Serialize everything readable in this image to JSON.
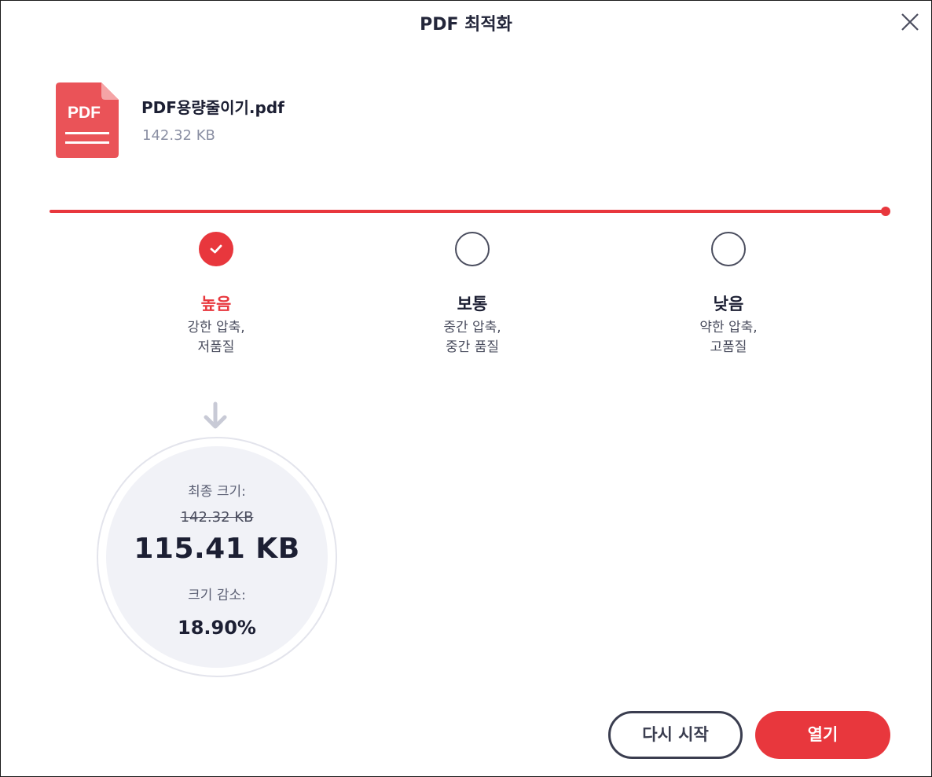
{
  "dialog": {
    "title": "PDF 최적화",
    "close_icon": "close-icon"
  },
  "file": {
    "icon": "pdf-file-icon",
    "icon_label": "PDF",
    "name": "PDF용량줄이기.pdf",
    "size": "142.32 KB"
  },
  "compression": {
    "slider_value": 1.0,
    "options": [
      {
        "title": "높음",
        "desc_line1": "강한 압축,",
        "desc_line2": "저품질",
        "selected": true
      },
      {
        "title": "보통",
        "desc_line1": "중간 압축,",
        "desc_line2": "중간 품질",
        "selected": false
      },
      {
        "title": "낮음",
        "desc_line1": "약한 압축,",
        "desc_line2": "고품질",
        "selected": false
      }
    ]
  },
  "result": {
    "arrow_icon": "arrow-down-icon",
    "final_label": "최종 크기:",
    "original_size": "142.32 KB",
    "final_size": "115.41 KB",
    "reduction_label": "크기 감소:",
    "reduction_value": "18.90%"
  },
  "buttons": {
    "restart_label": "다시 시작",
    "open_label": "열기"
  },
  "colors": {
    "accent": "#e8373d",
    "text_dark": "#1c1f33",
    "text_muted": "#8a8fa3",
    "result_bg": "#f1f2f7"
  }
}
